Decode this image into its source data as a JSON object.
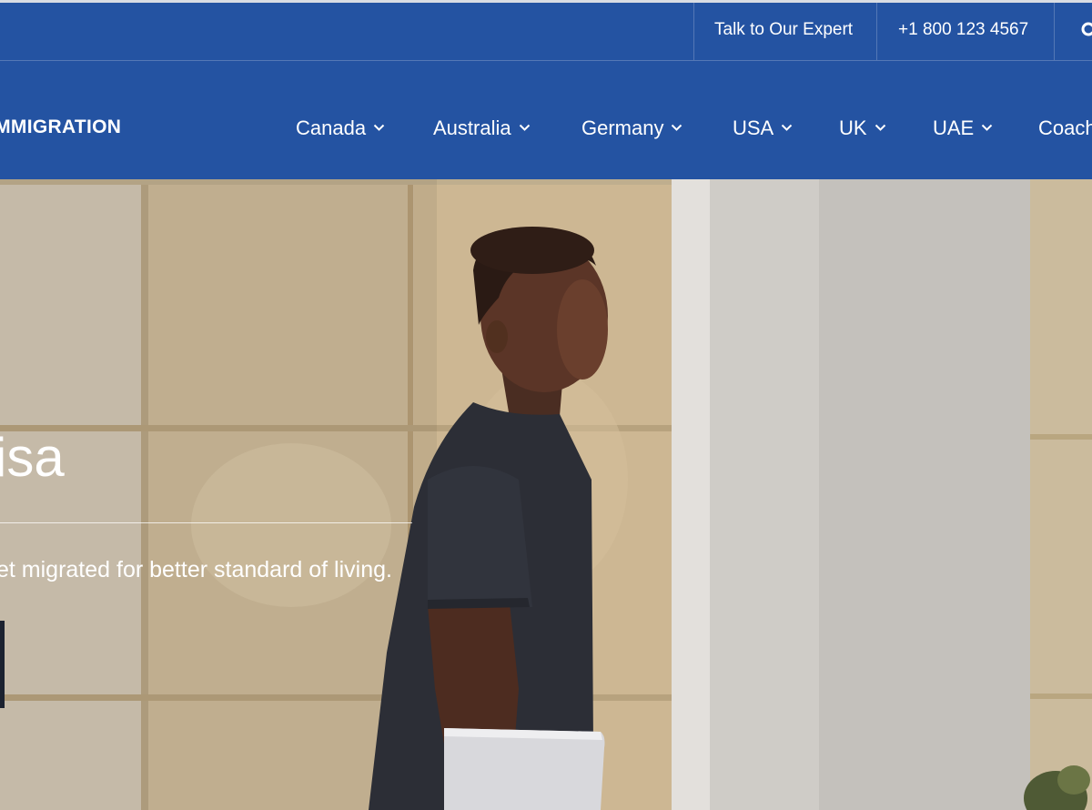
{
  "topbar": {
    "expert_label": "Talk to Our Expert",
    "phone": "+1 800 123 4567"
  },
  "nav": {
    "logo": "IMMIGRATION",
    "items": [
      {
        "label": "Canada",
        "icon": "chevron-down-icon"
      },
      {
        "label": "Australia",
        "icon": "chevron-down-icon"
      },
      {
        "label": "Germany",
        "icon": "chevron-down-icon"
      },
      {
        "label": "USA",
        "icon": "chevron-down-icon"
      },
      {
        "label": "UK",
        "icon": "chevron-down-icon"
      },
      {
        "label": "UAE",
        "icon": "chevron-down-icon"
      },
      {
        "label": "Coach"
      }
    ]
  },
  "hero": {
    "title": "isa",
    "subtitle": "et migrated for better standard of living."
  },
  "colors": {
    "brand_blue": "#2453a2",
    "button_dark": "#1c2230"
  }
}
